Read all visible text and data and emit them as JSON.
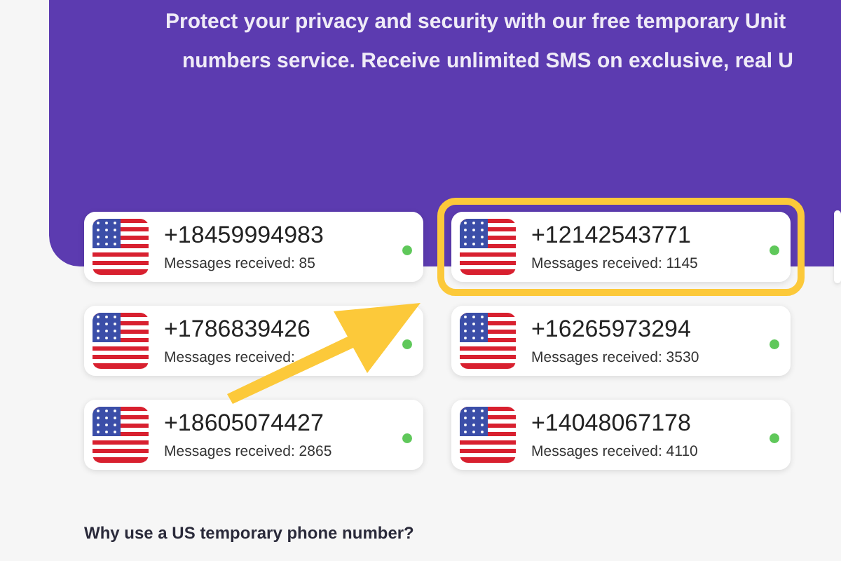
{
  "hero": {
    "lines": [
      "Protect your privacy and security with our free temporary Unit",
      "numbers service. Receive unlimited SMS on exclusive, real U"
    ]
  },
  "numbers": [
    {
      "number": "+18459994983",
      "messages": "Messages received: 85",
      "online": true,
      "highlighted": false
    },
    {
      "number": "+12142543771",
      "messages": "Messages received: 1145",
      "online": true,
      "highlighted": true
    },
    {
      "number": "+1786839426",
      "messages": "Messages received:",
      "online": true,
      "highlighted": false
    },
    {
      "number": "+16265973294",
      "messages": "Messages received: 3530",
      "online": true,
      "highlighted": false
    },
    {
      "number": "+18605074427",
      "messages": "Messages received: 2865",
      "online": true,
      "highlighted": false
    },
    {
      "number": "+14048067178",
      "messages": "Messages received: 4110",
      "online": true,
      "highlighted": false
    }
  ],
  "section_heading": "Why use a US temporary phone number?"
}
